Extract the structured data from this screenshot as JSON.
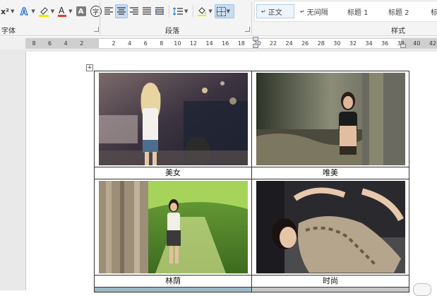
{
  "ribbon": {
    "font_group_label": "字体",
    "paragraph_group_label": "段落",
    "styles_group_label": "样式",
    "styles": [
      {
        "label": "正文",
        "prefix": "↵",
        "selected": true
      },
      {
        "label": "无间隔",
        "prefix": "↵",
        "selected": false
      },
      {
        "label": "标题 1",
        "prefix": "",
        "selected": false
      },
      {
        "label": "标题 2",
        "prefix": "",
        "selected": false
      },
      {
        "label": "标",
        "prefix": "",
        "selected": false
      }
    ],
    "superscript_label": "x²",
    "font_color_letter": "A",
    "char_shading_letter": "A",
    "enclose_char_label": "字"
  },
  "ruler": {
    "ticks": [
      "8",
      "6",
      "4",
      "2",
      "",
      "2",
      "4",
      "6",
      "8",
      "10",
      "12",
      "14",
      "16",
      "18",
      "20",
      "22",
      "24",
      "26",
      "28",
      "30",
      "32",
      "34",
      "36",
      "38",
      "40",
      "42"
    ]
  },
  "table": {
    "captions": [
      "美女",
      "唯美",
      "林荫",
      "时尚"
    ]
  },
  "colors": {
    "ribbon_bg": "#f4f4f4",
    "highlight": "#c8dcf0",
    "font_color_red": "#e03a2f",
    "highlighter_yellow": "#f2e600"
  }
}
